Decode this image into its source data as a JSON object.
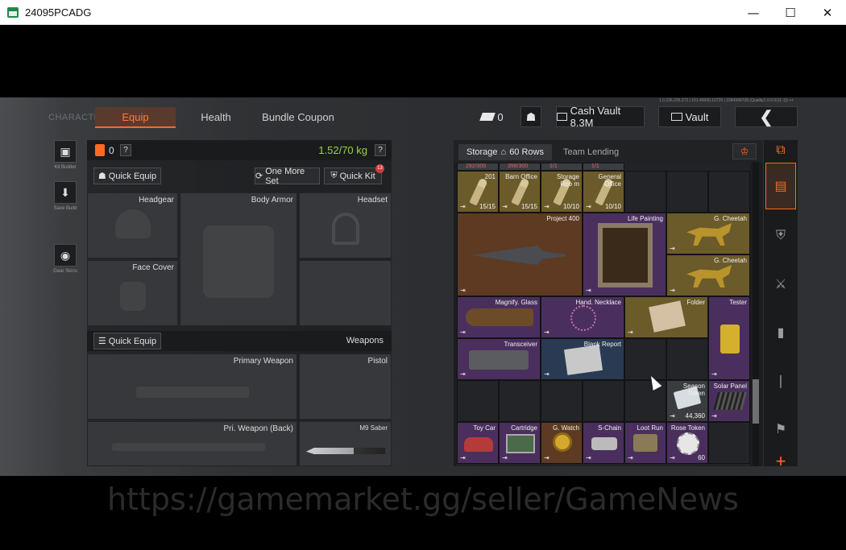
{
  "window": {
    "title": "24095PCADG",
    "minimize": "—",
    "maximize": "☐",
    "close": "✕"
  },
  "top_nav": {
    "character_label": "CHARACTER",
    "tabs": [
      "Equip",
      "Health",
      "Bundle Coupon"
    ],
    "active_tab": "Equip",
    "bonds_value": "0",
    "cash_vault_label": "Cash Vault 8.3M",
    "vault_label": "Vault",
    "back_icon": "chevron-left-icon",
    "version_text": "1.0.236.236.272 | 151.40000.10720 | 1584349728 (Quality1.0-0.0(11-1)) ++"
  },
  "side_tools": [
    {
      "label": "Kit Builder",
      "icon": "kit-builder-icon"
    },
    {
      "label": "Save Build",
      "icon": "download-icon"
    },
    {
      "label": "Gear Skins",
      "icon": "gear-skins-icon"
    }
  ],
  "equip": {
    "backpack_count": "0",
    "help_label": "?",
    "weight": "1.52/70 kg",
    "quick_equip_label": "Quick Equip",
    "one_more_set_label": "One More Set",
    "quick_kit_label": "Quick Kit",
    "quick_kit_badge": "13",
    "slots": {
      "headgear": "Headgear",
      "body_armor": "Body Armor",
      "headset": "Headset",
      "face_cover": "Face Cover"
    },
    "weapons_label": "Weapons",
    "weapons_quick_equip_label": "Quick Equip",
    "weapon_slots": {
      "primary": "Primary Weapon",
      "pistol": "Pistol",
      "pri_back": "Pri. Weapon (Back)",
      "melee": "M9 Saber"
    }
  },
  "storage": {
    "tab_label": "Storage",
    "rows_label": "60 Rows",
    "team_lending_label": "Team Lending",
    "partial_row_counts": [
      "292/300",
      "398/300",
      "1/1",
      "1/1"
    ],
    "items": [
      {
        "name": "201",
        "count": "15/15"
      },
      {
        "name": "Barn Office",
        "count": "15/15"
      },
      {
        "name": "Storage Roo m",
        "count": "10/10"
      },
      {
        "name": "General Office",
        "count": "10/10"
      },
      {
        "name": "Project 400",
        "count": ""
      },
      {
        "name": "Life Painting",
        "count": ""
      },
      {
        "name": "G. Cheetah",
        "count": ""
      },
      {
        "name": "G. Cheetah",
        "count": ""
      },
      {
        "name": "Magnify. Glass",
        "count": ""
      },
      {
        "name": "Hand. Necklace",
        "count": ""
      },
      {
        "name": "Folder",
        "count": ""
      },
      {
        "name": "Tester",
        "count": ""
      },
      {
        "name": "Transceiver",
        "count": ""
      },
      {
        "name": "Blank Report",
        "count": ""
      },
      {
        "name": "Season Token",
        "count": "44,360"
      },
      {
        "name": "Solar Panel",
        "count": ""
      },
      {
        "name": "Toy Car",
        "count": ""
      },
      {
        "name": "Cartridge",
        "count": ""
      },
      {
        "name": "G. Watch",
        "count": ""
      },
      {
        "name": "S-Chain",
        "count": ""
      },
      {
        "name": "Loot Run",
        "count": ""
      },
      {
        "name": "Rose Token",
        "count": "60"
      }
    ],
    "mark_glyph": "⇥",
    "colors": {
      "gold": "#6b5a2a",
      "orange": "#5e3a22",
      "purple": "#4a2f5e",
      "blue": "#2a3a52",
      "gray": "#3a3c40"
    }
  },
  "right_nav": {
    "icons": [
      "storage-swap-icon",
      "armor-icon",
      "rifle-icon",
      "magazine-icon",
      "ammo-icon",
      "vest-icon",
      "plus-icon"
    ]
  },
  "watermark": "https://gamemarket.gg/seller/GameNews"
}
